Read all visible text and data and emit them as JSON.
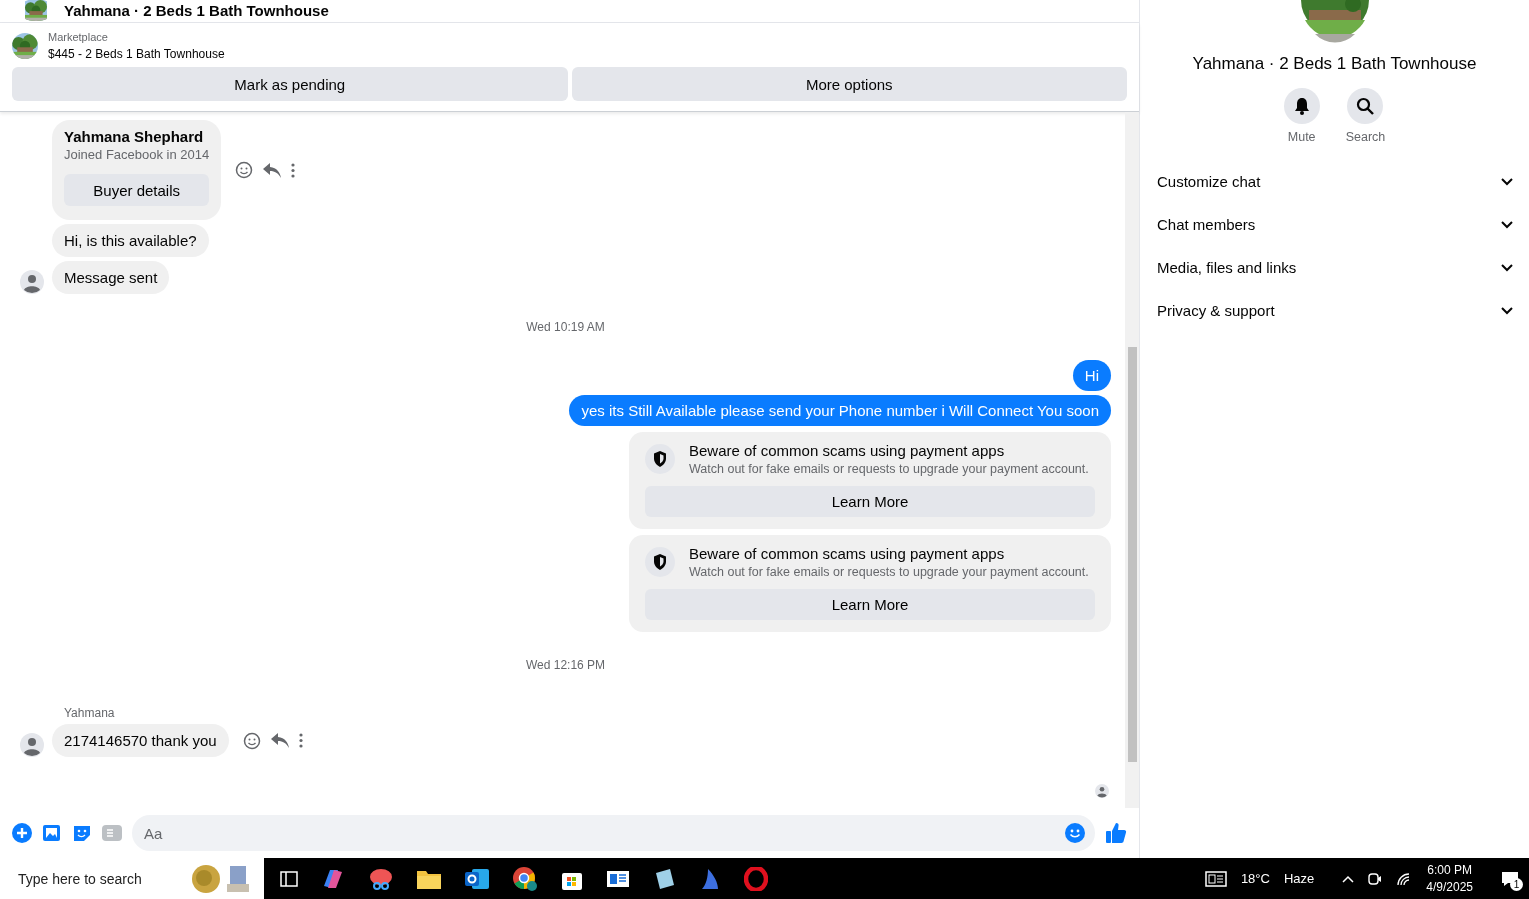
{
  "header": {
    "title": "Yahmana · 2 Beds 1 Bath Townhouse"
  },
  "listing": {
    "source": "Marketplace",
    "title": "$445 - 2 Beds 1 Bath Townhouse",
    "actions": [
      "Mark as pending",
      "More options"
    ]
  },
  "messages": [
    {
      "kind": "profile",
      "name": "Yahmana Shephard",
      "subtitle": "Joined Facebook in 2014",
      "button": "Buyer details",
      "hover_actions": true
    },
    {
      "kind": "incoming",
      "text": "Hi, is this available?",
      "avatar": false,
      "hover_actions": false
    },
    {
      "kind": "incoming",
      "text": "Message sent",
      "avatar": true,
      "hover_actions": false
    },
    {
      "kind": "timestamp",
      "text": "Wed 10:19 AM"
    },
    {
      "kind": "outgoing",
      "text": "Hi"
    },
    {
      "kind": "outgoing",
      "text": "yes its Still Available please send your Phone number i Will Connect You soon"
    },
    {
      "kind": "notice",
      "title": "Beware of common scams using payment apps",
      "body": "Watch out for fake emails or requests to upgrade your payment account.",
      "button": "Learn More"
    },
    {
      "kind": "notice",
      "title": "Beware of common scams using payment apps",
      "body": "Watch out for fake emails or requests to upgrade your payment account.",
      "button": "Learn More"
    },
    {
      "kind": "timestamp",
      "text": "Wed 12:16 PM"
    },
    {
      "kind": "sender",
      "text": "Yahmana"
    },
    {
      "kind": "incoming",
      "text": "2174146570 thank you",
      "avatar": true,
      "hover_actions": true
    }
  ],
  "composer": {
    "placeholder": "Aa"
  },
  "panel": {
    "title": "Yahmana · 2 Beds 1 Bath Townhouse",
    "actions": [
      {
        "label": "Mute",
        "kind": "mute"
      },
      {
        "label": "Search",
        "kind": "search"
      }
    ],
    "sections": [
      {
        "label": "Customize chat",
        "expanded": false
      },
      {
        "label": "Chat members",
        "expanded": false
      },
      {
        "label": "Media, files and links",
        "expanded": false
      },
      {
        "label": "Privacy & support",
        "expanded": false
      }
    ]
  },
  "taskbar": {
    "search_placeholder": "Type here to search",
    "temperature": "18°C",
    "condition": "Haze",
    "time": "6:00 PM",
    "date": "4/9/2025",
    "notifications": "1"
  }
}
